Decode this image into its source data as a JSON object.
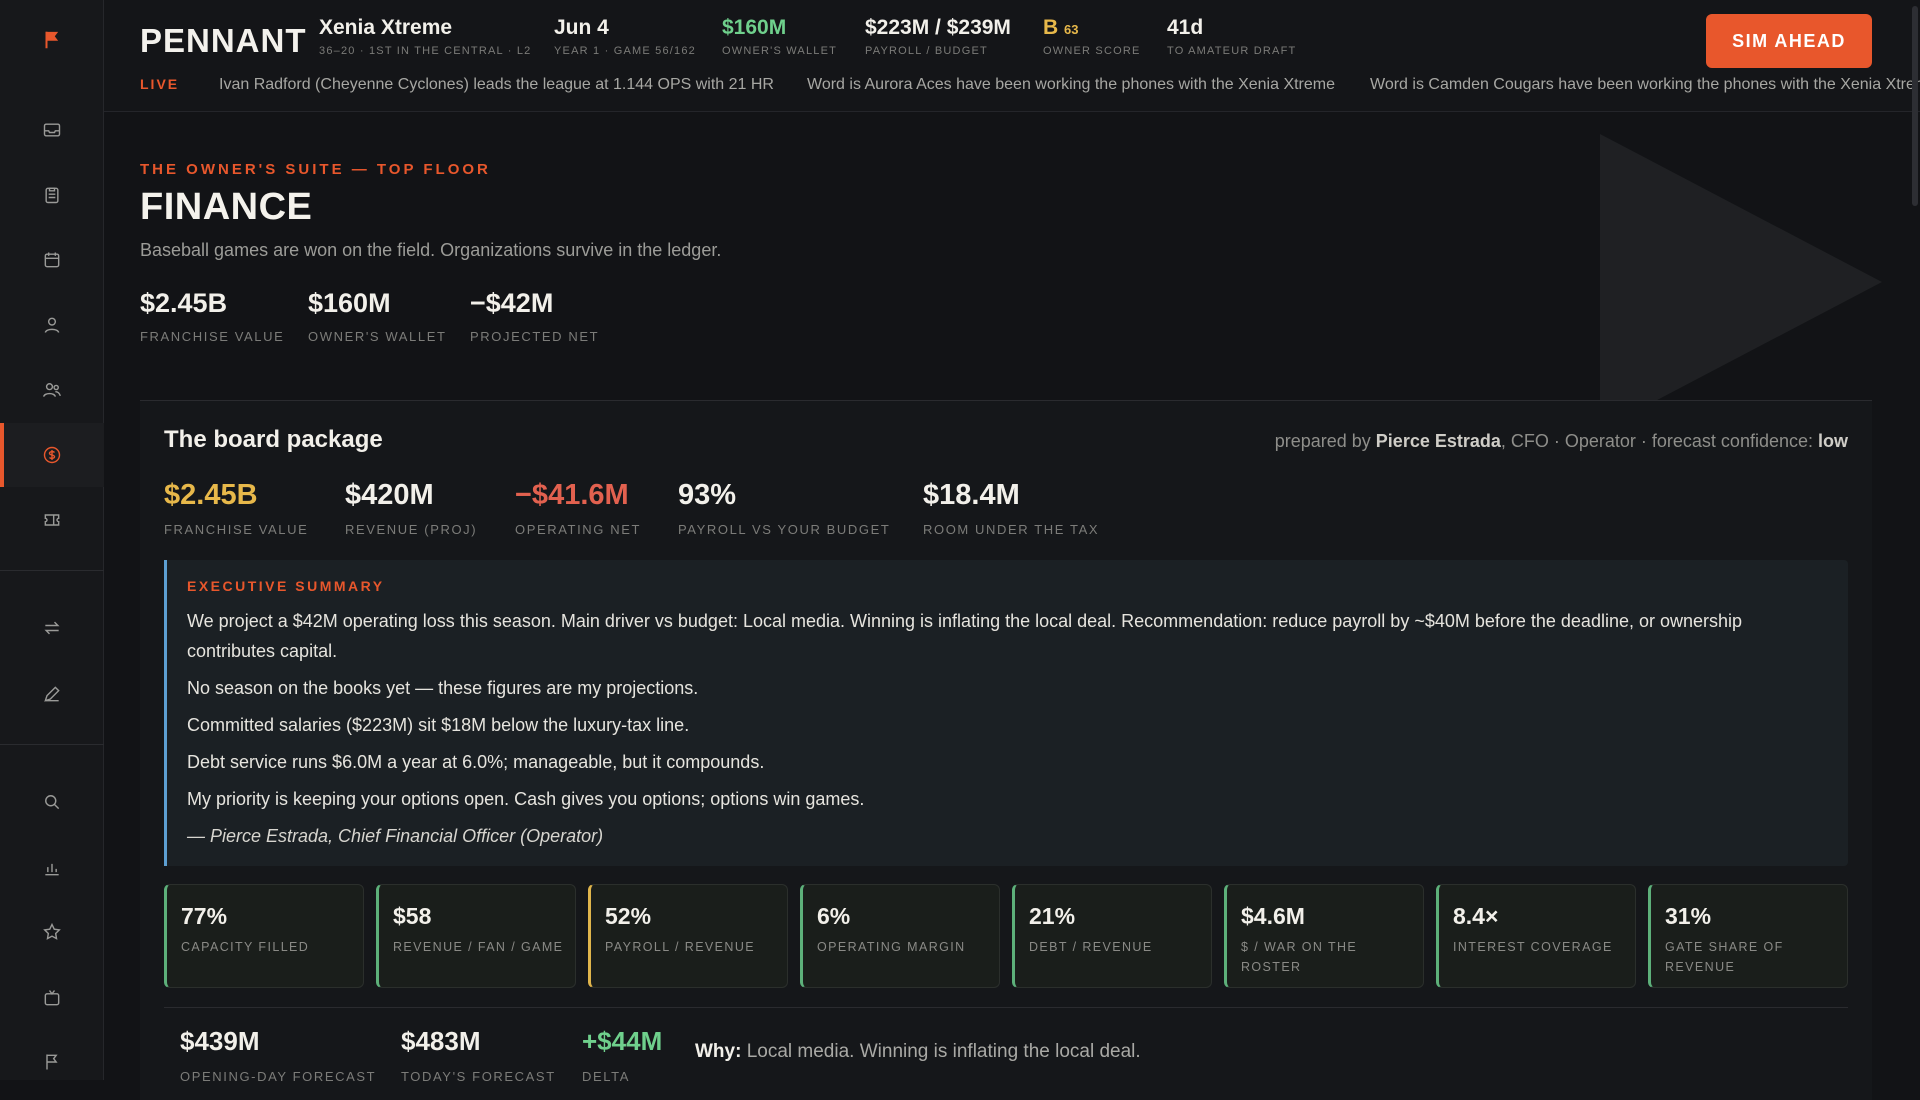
{
  "app": {
    "brand": "PENNANT"
  },
  "topbar": {
    "team": {
      "name": "Xenia Xtreme",
      "sub": "36–20 · 1ST IN THE CENTRAL · L2"
    },
    "date": {
      "value": "Jun 4",
      "sub": "YEAR 1 · GAME 56/162"
    },
    "wallet": {
      "value": "$160M",
      "sub": "OWNER'S WALLET"
    },
    "payroll": {
      "value": "$223M / $239M",
      "sub": "PAYROLL / BUDGET"
    },
    "score": {
      "grade": "B",
      "num": "63",
      "sub": "OWNER SCORE"
    },
    "draft": {
      "value": "41d",
      "sub": "TO AMATEUR DRAFT"
    },
    "sim_label": "SIM AHEAD"
  },
  "ticker": {
    "live": "LIVE",
    "items": [
      "Ivan Radford (Cheyenne Cyclones) leads the league at 1.144 OPS with 21 HR",
      "Word is Aurora Aces have been working the phones with the Xenia Xtreme",
      "Word is Camden Cougars have been working the phones with the Xenia Xtreme"
    ]
  },
  "page": {
    "eyebrow": "THE OWNER'S SUITE — TOP FLOOR",
    "title": "FINANCE",
    "subtitle": "Baseball games are won on the field. Organizations survive in the ledger.",
    "stats": [
      {
        "value": "$2.45B",
        "label": "FRANCHISE VALUE"
      },
      {
        "value": "$160M",
        "label": "OWNER'S WALLET"
      },
      {
        "value": "−$42M",
        "label": "PROJECTED NET"
      }
    ]
  },
  "board": {
    "title": "The board package",
    "prepared_prefix": "prepared by ",
    "prepared_name": "Pierce Estrada",
    "prepared_mid": ", CFO · Operator · forecast confidence: ",
    "confidence": "low",
    "stats": [
      {
        "value": "$2.45B",
        "label": "FRANCHISE VALUE",
        "tone": "gold"
      },
      {
        "value": "$420M",
        "label": "REVENUE (PROJ)",
        "tone": "normal"
      },
      {
        "value": "−$41.6M",
        "label": "OPERATING NET",
        "tone": "red"
      },
      {
        "value": "93%",
        "label": "PAYROLL VS YOUR BUDGET",
        "tone": "normal"
      },
      {
        "value": "$18.4M",
        "label": "ROOM UNDER THE TAX",
        "tone": "normal"
      }
    ],
    "summary": {
      "eyebrow": "EXECUTIVE SUMMARY",
      "lines": [
        "We project a $42M operating loss this season. Main driver vs budget: Local media. Winning is inflating the local deal. Recommendation: reduce payroll by ~$40M before the deadline, or ownership contributes capital.",
        "No season on the books yet — these figures are my projections.",
        "Committed salaries ($223M) sit $18M below the luxury-tax line.",
        "Debt service runs $6.0M a year at 6.0%; manageable, but it compounds.",
        "My priority is keeping your options open. Cash gives you options; options win games."
      ],
      "signature": "— Pierce Estrada, Chief Financial Officer (Operator)"
    },
    "cards": [
      {
        "value": "77%",
        "label": "CAPACITY FILLED"
      },
      {
        "value": "$58",
        "label": "REVENUE / FAN / GAME"
      },
      {
        "value": "52%",
        "label": "PAYROLL / REVENUE"
      },
      {
        "value": "6%",
        "label": "OPERATING MARGIN"
      },
      {
        "value": "21%",
        "label": "DEBT / REVENUE"
      },
      {
        "value": "$4.6M",
        "label": "$ / WAR ON THE ROSTER"
      },
      {
        "value": "8.4×",
        "label": "INTEREST COVERAGE"
      },
      {
        "value": "31%",
        "label": "GATE SHARE OF REVENUE"
      }
    ],
    "forecast": [
      {
        "value": "$439M",
        "label": "OPENING-DAY FORECAST"
      },
      {
        "value": "$483M",
        "label": "TODAY'S FORECAST"
      },
      {
        "value": "+$44M",
        "label": "DELTA"
      }
    ],
    "why_label": "Why:",
    "why_text": " Local media. Winning is inflating the local deal."
  },
  "colors": {
    "accent": "#e8572c",
    "positive": "#6fd08c",
    "negative": "#e2614f",
    "gold": "#e7b84a",
    "info": "#5d9fd2"
  }
}
